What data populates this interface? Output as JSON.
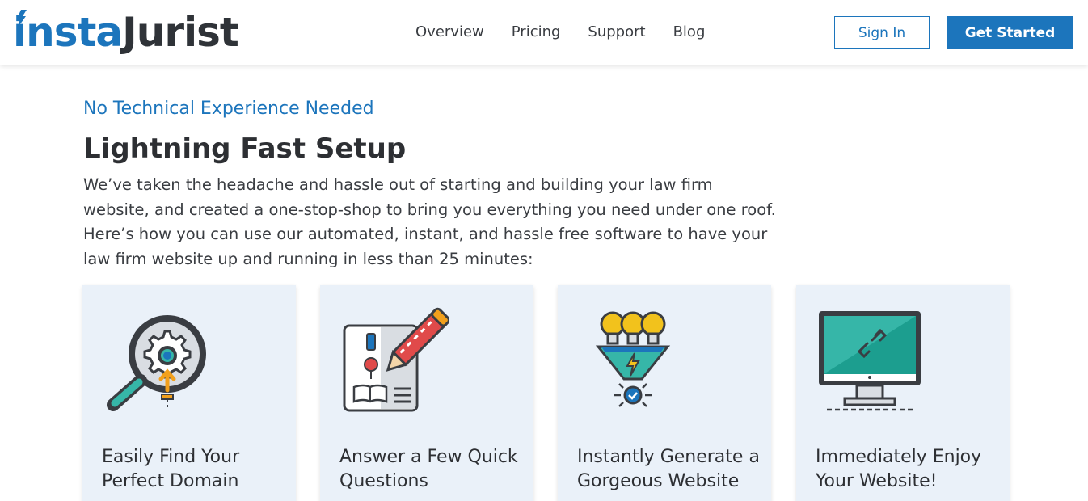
{
  "header": {
    "logo": {
      "part1": "insta",
      "part2": "Jurist"
    },
    "nav": [
      "Overview",
      "Pricing",
      "Support",
      "Blog"
    ],
    "sign_in": "Sign In",
    "get_started": "Get Started"
  },
  "hero": {
    "eyebrow": "No Technical Experience Needed",
    "title": "Lightning Fast Setup",
    "description": "We’ve taken the headache and hassle out of starting and building your law firm website, and created a one-stop-shop to bring you everything you need under one roof. Here’s how you can use our automated, instant, and hassle free software to have your law firm website up and running in less than 25 minutes:"
  },
  "cards": [
    {
      "icon": "magnifier-gear-icon",
      "title": "Easily Find Your Perfect Domain"
    },
    {
      "icon": "form-pencil-icon",
      "title": "Answer a Few Quick Questions"
    },
    {
      "icon": "lightbulbs-funnel-icon",
      "title": "Instantly Generate a Gorgeous Website"
    },
    {
      "icon": "monitor-link-icon",
      "title": "Immediately Enjoy Your Website!"
    }
  ],
  "colors": {
    "brand": "#1c75bc",
    "dark": "#2f3338",
    "card_bg": "#eaf1f9"
  }
}
